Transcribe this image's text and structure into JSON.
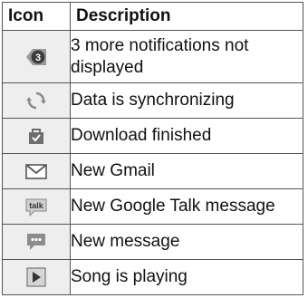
{
  "table": {
    "headers": {
      "icon": "Icon",
      "description": "Description"
    },
    "rows": [
      {
        "icon": "more-notifications-badge-icon",
        "badge": "3",
        "description": "3 more notifications not displayed"
      },
      {
        "icon": "sync-icon",
        "description": "Data is synchronizing"
      },
      {
        "icon": "download-finished-icon",
        "description": "Download finished"
      },
      {
        "icon": "gmail-icon",
        "description": "New Gmail"
      },
      {
        "icon": "google-talk-icon",
        "badge": "talk",
        "description": "New Google Talk message"
      },
      {
        "icon": "new-message-icon",
        "description": "New message"
      },
      {
        "icon": "play-icon",
        "description": "Song is playing"
      }
    ]
  }
}
